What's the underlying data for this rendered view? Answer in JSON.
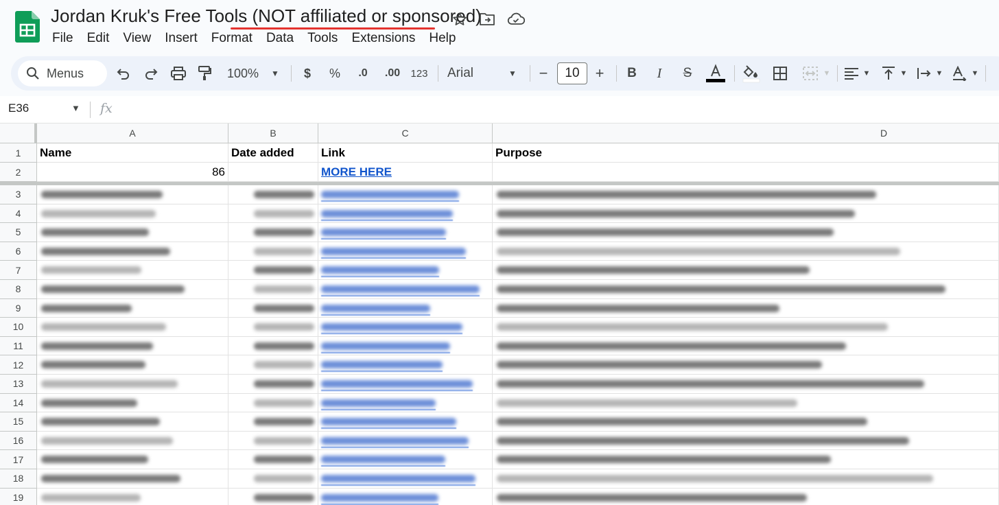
{
  "doc_title": "Jordan Kruk's Free Tools (NOT affiliated or sponsored)",
  "menus": [
    "File",
    "Edit",
    "View",
    "Insert",
    "Format",
    "Data",
    "Tools",
    "Extensions",
    "Help"
  ],
  "toolbar": {
    "search_label": "Menus",
    "zoom": "100%",
    "currency": "$",
    "percent": "%",
    "decrease_decimal": ".0",
    "increase_decimal": ".00",
    "number_format": "123",
    "font": "Arial",
    "font_size": "10",
    "minus": "−",
    "plus": "+"
  },
  "formula_bar": {
    "name_box": "E36",
    "fx": "fx"
  },
  "columns": [
    "A",
    "B",
    "C",
    "D"
  ],
  "rows": [
    "1",
    "2",
    "3",
    "4",
    "5",
    "6",
    "7",
    "8",
    "9",
    "10",
    "11",
    "12",
    "13",
    "14",
    "15",
    "16",
    "17",
    "18",
    "19"
  ],
  "header_row": {
    "name": "Name",
    "date_added": "Date added",
    "link": "Link",
    "purpose": "Purpose"
  },
  "row2": {
    "count": "86",
    "link": "MORE HERE"
  },
  "colors": {
    "accent_green": "#0f9d58",
    "link_blue": "#1155cc",
    "title_underline": "#e4332f",
    "toolbar_bg": "#edf2fa"
  },
  "icons": [
    "sheets-logo-icon",
    "star-icon",
    "move-folder-icon",
    "cloud-status-icon",
    "search-icon",
    "undo-icon",
    "redo-icon",
    "print-icon",
    "paint-format-icon",
    "bold-icon",
    "italic-icon",
    "strikethrough-icon",
    "text-color-icon",
    "fill-color-icon",
    "borders-icon",
    "merge-cells-icon",
    "align-left-icon",
    "vertical-align-icon",
    "text-wrap-icon",
    "text-rotation-icon",
    "fx-icon"
  ]
}
